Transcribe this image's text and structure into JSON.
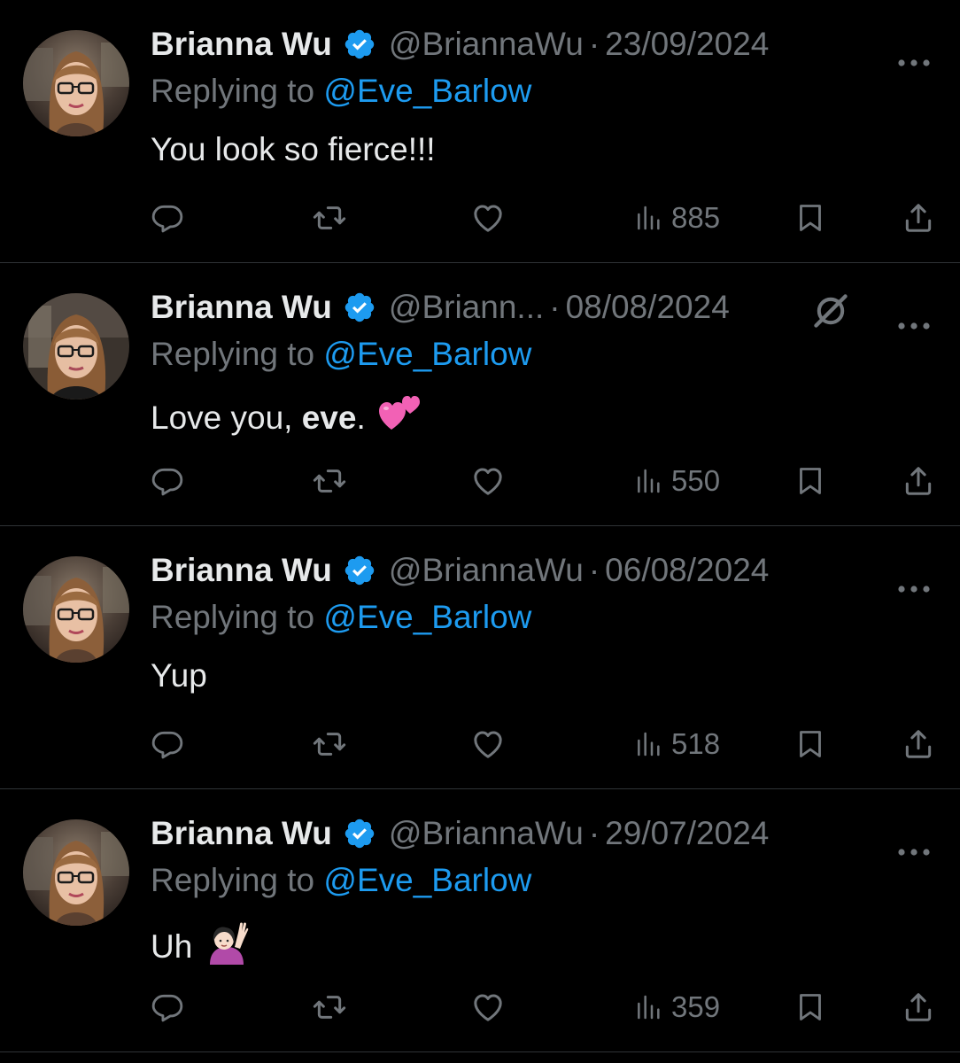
{
  "colors": {
    "background": "#000000",
    "primary_text": "#e7e9ea",
    "secondary_text": "#71767b",
    "link": "#1d9bf0",
    "verified_badge": "#1d9bf0",
    "divider": "#2f3336"
  },
  "tweets": [
    {
      "display_name": "Brianna Wu",
      "handle": "@BriannaWu",
      "separator": "·",
      "date": "23/09/2024",
      "replying_prefix": "Replying to",
      "replying_to": "@Eve_Barlow",
      "text": "You look so fierce!!!",
      "views": "885"
    },
    {
      "display_name": "Brianna Wu",
      "handle": "@Briann...",
      "separator": "·",
      "date": "08/08/2024",
      "replying_prefix": "Replying to",
      "replying_to": "@Eve_Barlow",
      "text_start": "Love you, ",
      "text_bold": "eve",
      "text_end": ".",
      "emoji": "two-hearts-emoji",
      "views": "550"
    },
    {
      "display_name": "Brianna Wu",
      "handle": "@BriannaWu",
      "separator": "·",
      "date": "06/08/2024",
      "replying_prefix": "Replying to",
      "replying_to": "@Eve_Barlow",
      "text": "Yup",
      "views": "518"
    },
    {
      "display_name": "Brianna Wu",
      "handle": "@BriannaWu",
      "separator": "·",
      "date": "29/07/2024",
      "replying_prefix": "Replying to",
      "replying_to": "@Eve_Barlow",
      "text": "Uh",
      "emoji": "person-raising-hand-emoji",
      "views": "359"
    }
  ]
}
